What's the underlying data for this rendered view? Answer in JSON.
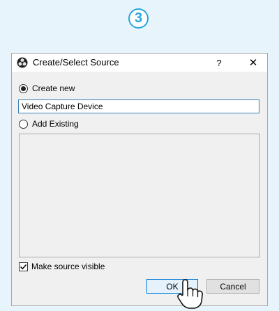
{
  "step": {
    "number": "3"
  },
  "dialog": {
    "title": "Create/Select Source",
    "help_label": "?",
    "close_label": "✕",
    "create_new_label": "Create new",
    "create_new_selected": true,
    "source_name_value": "Video Capture Device",
    "add_existing_label": "Add Existing",
    "add_existing_selected": false,
    "make_visible_label": "Make source visible",
    "make_visible_checked": true,
    "ok_label": "OK",
    "cancel_label": "Cancel"
  },
  "icons": {
    "app": "obs-logo-icon",
    "cursor": "pointing-hand-cursor-icon"
  },
  "colors": {
    "page_background": "#e8f4fb",
    "step_accent": "#28a6dc",
    "input_border": "#3c7fb1",
    "ok_border": "#0078d7"
  }
}
